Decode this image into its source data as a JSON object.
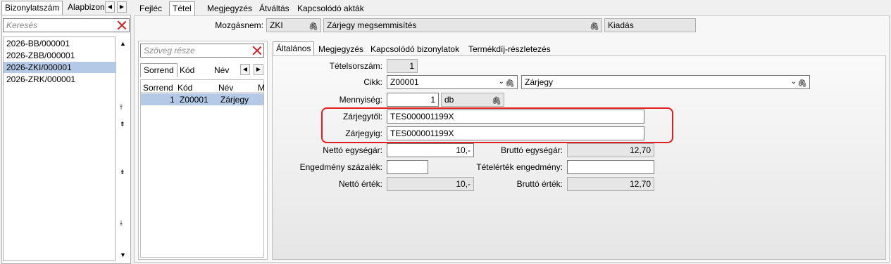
{
  "left_panel": {
    "tabs": [
      "Bizonylatszám",
      "Alapbizon"
    ],
    "search_placeholder": "Keresés",
    "items": [
      "2026-BB/000001",
      "2026-ZBB/000001",
      "2026-ZKI/000001",
      "2026-ZRK/000001"
    ],
    "selected_index": 2
  },
  "top_tabs": [
    "Fejléc",
    "Tétel",
    "Megjegyzés",
    "Átváltás",
    "Kapcsolódó akták"
  ],
  "header": {
    "movement_label": "Mozgásnem:",
    "movement_code": "ZKI",
    "movement_name": "Zárjegy megsemmisítés",
    "movement_type": "Kiadás"
  },
  "mid_panel": {
    "search_placeholder": "Szöveg része",
    "sort_tabs": [
      "Sorrend",
      "Kód",
      "Név"
    ],
    "columns": [
      "Sorrend",
      "Kód",
      "Név",
      "M"
    ],
    "rows": [
      {
        "order": "1",
        "code": "Z00001",
        "name": "Zárjegy"
      }
    ]
  },
  "sub_tabs": [
    "Általános",
    "Megjegyzés",
    "Kapcsolódó bizonylatok",
    "Termékdíj-részletezés"
  ],
  "form": {
    "line_no_label": "Tételsorszám:",
    "line_no": "1",
    "item_label": "Cikk:",
    "item_code": "Z00001",
    "item_name": "Zárjegy",
    "qty_label": "Mennyiség:",
    "qty": "1",
    "unit": "db",
    "from_label": "Zárjegytől:",
    "from_value": "TES000001199X",
    "to_label": "Zárjegyig:",
    "to_value": "TES000001199X",
    "net_unit_label": "Nettó egységár:",
    "net_unit": "10,-",
    "gross_unit_label": "Bruttó egységár:",
    "gross_unit": "12,70",
    "discount_pct_label": "Engedmény százalék:",
    "discount_pct": "",
    "line_discount_label": "Tételérték engedmény:",
    "line_discount": "",
    "net_value_label": "Nettó érték:",
    "net_value": "10,-",
    "gross_value_label": "Bruttó érték:",
    "gross_value": "12,70"
  },
  "colors": {
    "selection": "#b3c9e6",
    "highlight": "#e02020"
  }
}
